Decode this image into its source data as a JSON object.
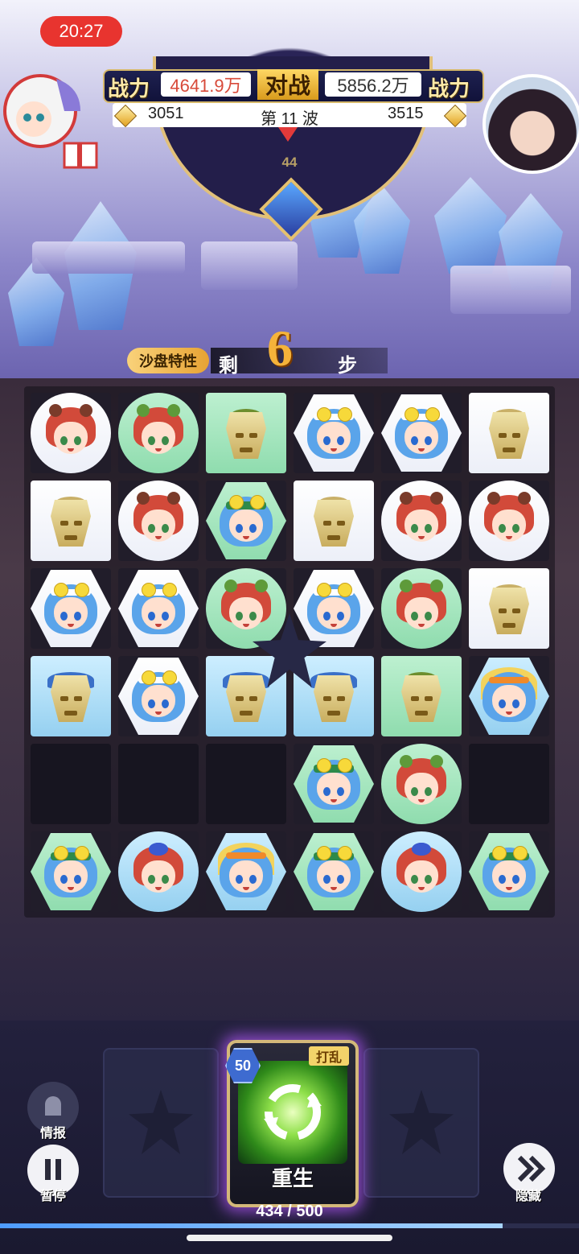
{
  "status": {
    "time": "20:27"
  },
  "battle": {
    "left_power_label": "战力",
    "left_power": "4641.9万",
    "vs_label": "对战",
    "right_power": "5856.2万",
    "right_power_label": "战力",
    "left_score": "3051",
    "wave": "第 11 波",
    "right_score": "3515",
    "center_value": "44"
  },
  "board_info": {
    "special_label": "沙盘特性",
    "steps_prefix": "剩",
    "steps_left": "6",
    "steps_suffix": "步"
  },
  "board": {
    "rows": [
      [
        {
          "hero": "red",
          "bg": "white",
          "shape": "circle"
        },
        {
          "hero": "red-hat",
          "bg": "green",
          "shape": "circle"
        },
        {
          "hero": "beast-green",
          "bg": "green",
          "shape": "square"
        },
        {
          "hero": "blue",
          "bg": "white",
          "shape": "hex"
        },
        {
          "hero": "blue",
          "bg": "white",
          "shape": "hex"
        },
        {
          "hero": "beast",
          "bg": "white",
          "shape": "square"
        }
      ],
      [
        {
          "hero": "beast",
          "bg": "white",
          "shape": "square"
        },
        {
          "hero": "red",
          "bg": "white",
          "shape": "circle"
        },
        {
          "hero": "blue-goggles",
          "bg": "green",
          "shape": "hex"
        },
        {
          "hero": "beast",
          "bg": "white",
          "shape": "square"
        },
        {
          "hero": "red",
          "bg": "white",
          "shape": "circle"
        },
        {
          "hero": "red",
          "bg": "white",
          "shape": "circle"
        }
      ],
      [
        {
          "hero": "blue",
          "bg": "white",
          "shape": "hex"
        },
        {
          "hero": "blue",
          "bg": "white",
          "shape": "hex"
        },
        {
          "hero": "red-hat",
          "bg": "green",
          "shape": "circle"
        },
        {
          "hero": "blue",
          "bg": "white",
          "shape": "hex"
        },
        {
          "hero": "red-hat",
          "bg": "green",
          "shape": "circle"
        },
        {
          "hero": "beast",
          "bg": "white",
          "shape": "square"
        }
      ],
      [
        {
          "hero": "beast-blue",
          "bg": "blue",
          "shape": "square"
        },
        {
          "hero": "blue",
          "bg": "white",
          "shape": "hex"
        },
        {
          "hero": "beast-blue",
          "bg": "blue",
          "shape": "square"
        },
        {
          "hero": "beast-blue",
          "bg": "blue",
          "shape": "square"
        },
        {
          "hero": "beast-green",
          "bg": "green",
          "shape": "square"
        },
        {
          "hero": "blue-orange",
          "bg": "blue",
          "shape": "hex"
        }
      ],
      [
        {
          "hero": "empty"
        },
        {
          "hero": "empty"
        },
        {
          "hero": "empty"
        },
        {
          "hero": "blue-goggles",
          "bg": "green",
          "shape": "hex"
        },
        {
          "hero": "red-hat",
          "bg": "green",
          "shape": "circle"
        },
        {
          "hero": "empty"
        }
      ],
      [
        {
          "hero": "blue-goggles",
          "bg": "green",
          "shape": "hex"
        },
        {
          "hero": "red-bluehat",
          "bg": "blue",
          "shape": "circle"
        },
        {
          "hero": "blue-orange",
          "bg": "blue",
          "shape": "hex"
        },
        {
          "hero": "blue-goggles",
          "bg": "green",
          "shape": "hex"
        },
        {
          "hero": "red-bluehat",
          "bg": "blue",
          "shape": "circle"
        },
        {
          "hero": "blue-goggles",
          "bg": "green",
          "shape": "hex"
        }
      ]
    ]
  },
  "controls": {
    "intel_label": "情报",
    "pause_label": "暂停",
    "hide_label": "隐藏",
    "skill_cost": "50",
    "skill_tag": "打乱",
    "skill_name": "重生",
    "energy_text": "434 / 500",
    "energy_fraction": 0.868
  },
  "colors": {
    "accent_gold": "#d6b86a",
    "time_pill": "#e8342f",
    "skill_glow": "#b65aff"
  }
}
